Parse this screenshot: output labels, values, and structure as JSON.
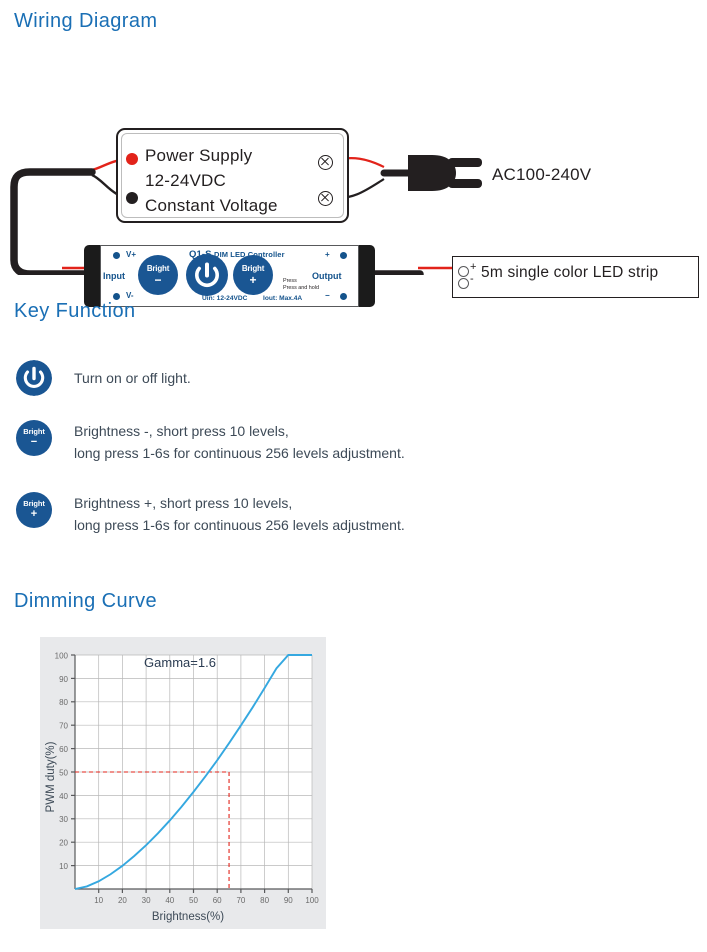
{
  "sections": {
    "wiring_title": "Wiring Diagram",
    "key_title": "Key Function",
    "dimming_title": "Dimming Curve"
  },
  "wiring": {
    "psu": {
      "line1": "Power Supply",
      "line2": "12-24VDC",
      "line3": "Constant Voltage"
    },
    "ac_label": "AC100-240V",
    "led_strip_label": "5m single color LED strip",
    "strip_plus": "+",
    "strip_minus": "-",
    "controller": {
      "model": "Q1-S",
      "subtitle": "DIM LED Controller",
      "uin": "Uin: 12-24VDC",
      "iout": "Iout: Max.4A",
      "press_line1": "Press",
      "press_line2": "Press and hold",
      "input_label": "Input",
      "output_label": "Output",
      "pin_vplus": "V+",
      "pin_vminus": "V-",
      "pin_out_plus": "+",
      "pin_out_minus": "−",
      "btn_minus_label": "Bright",
      "btn_minus_sign": "−",
      "btn_plus_label": "Bright",
      "btn_plus_sign": "+"
    }
  },
  "key_function": {
    "rows": [
      {
        "icon": "power-icon",
        "icon_label": "",
        "icon_sign": "",
        "lines": [
          "Turn on or off light."
        ]
      },
      {
        "icon": "bright-minus-icon",
        "icon_label": "Bright",
        "icon_sign": "−",
        "lines": [
          "Brightness -, short press 10 levels,",
          "long press 1-6s for continuous 256 levels adjustment."
        ]
      },
      {
        "icon": "bright-plus-icon",
        "icon_label": "Bright",
        "icon_sign": "+",
        "lines": [
          "Brightness +, short press 10 levels,",
          "long press 1-6s for continuous 256 levels adjustment."
        ]
      }
    ]
  },
  "colors": {
    "heading_blue": "#1a6fb5",
    "button_blue": "#1a5693",
    "curve_blue": "#35a8e0",
    "wire_red": "#e2231a",
    "wire_black": "#231f20",
    "panel_gray": "#e8e9eb"
  },
  "chart_data": {
    "type": "line",
    "title": "Dimming Curve",
    "annotation": "Gamma=1.6",
    "xlabel": "Brightness(%)",
    "ylabel": "PWM duty(%)",
    "xlim": [
      0,
      100
    ],
    "ylim": [
      0,
      100
    ],
    "xticks": [
      10,
      20,
      30,
      40,
      50,
      60,
      70,
      80,
      90,
      100
    ],
    "yticks": [
      10,
      20,
      30,
      40,
      50,
      60,
      70,
      80,
      90,
      100
    ],
    "grid": true,
    "legend": "none",
    "series": [
      {
        "name": "Gamma 1.6 curve",
        "x": [
          0,
          5,
          10,
          15,
          20,
          25,
          30,
          35,
          40,
          45,
          50,
          55,
          60,
          65,
          70,
          75,
          80,
          85,
          90,
          95,
          100
        ],
        "y": [
          0,
          1.1,
          3.3,
          6.3,
          9.9,
          14.1,
          18.7,
          23.8,
          29.3,
          35.2,
          41.5,
          48.1,
          55.0,
          62.3,
          69.9,
          77.7,
          85.9,
          94.3,
          100,
          100,
          100
        ]
      }
    ],
    "reference_lines": [
      {
        "name": "pwm-50-reference",
        "axis": "y",
        "value": 50,
        "style": "dashed",
        "color": "#e2231a"
      },
      {
        "name": "brightness-65-reference",
        "axis": "x",
        "value": 65,
        "style": "dashed",
        "color": "#e2231a"
      }
    ]
  }
}
